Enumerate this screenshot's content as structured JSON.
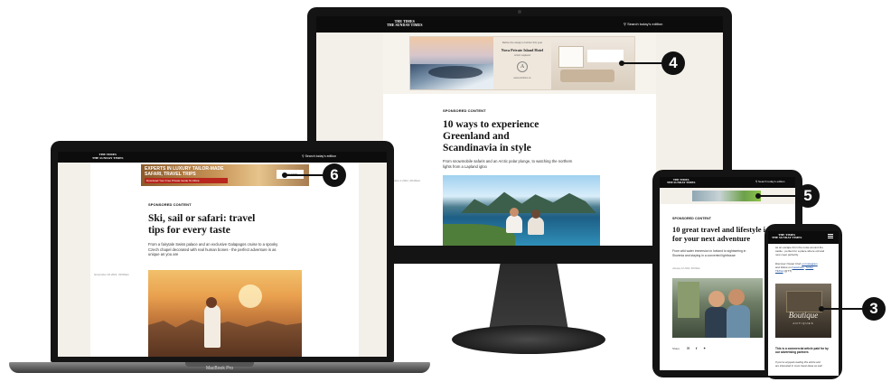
{
  "desktop": {
    "masthead": [
      "THE TIMES",
      "THE SUNDAY TIMES"
    ],
    "search_label": "Search today's edition",
    "ad": {
      "tagline": "Refine the design of winter this year",
      "hotel": "Nova Private Island Hotel",
      "location": "Arctic Lapland",
      "logo_glyph": "A",
      "url": "www.arcticlux.co"
    },
    "kicker": "SPONSORED CONTENT",
    "headline": [
      "10 ways to experience",
      "Greenland and",
      "Scandinavia in style"
    ],
    "standfirst": [
      "From snowmobile safaris and an Arctic polar plunge, to watching the northern",
      "lights from a Lapland igloo"
    ],
    "byline": "November 2 2021, 09:00am"
  },
  "laptop": {
    "masthead": [
      "THE TIMES",
      "THE SUNDAY TIMES"
    ],
    "search_label": "Search today's edition",
    "ad": {
      "title": "EXPERTS IN LUXURY TAILOR-MADE",
      "subtitle": "SAFARI, TRAVEL TRIPS",
      "cta": "Download Your Free Private Guide To Africa",
      "button": "PLAN NOW"
    },
    "kicker": "SPONSORED CONTENT",
    "headline": [
      "Ski, sail or safari: travel",
      "tips for every taste"
    ],
    "standfirst": [
      "From a fairytale Swiss palace and an exclusive Galapagos cruise to a spooky",
      "Czech chapel decorated with real human bones - the perfect adventure is as",
      "unique as you are"
    ],
    "byline": "November 16 2021, 09:00am",
    "brand": "MacBook Pro"
  },
  "tablet": {
    "masthead": [
      "THE TIMES",
      "THE SUNDAY TIMES"
    ],
    "search_label": "Search today's edition",
    "kicker": "SPONSORED CONTENT",
    "headline": [
      "10 great travel and lifestyle ide",
      "for your next adventure"
    ],
    "standfirst": [
      "From wild water immersion in Iceland to sightseeing in",
      "Slovenia and staying in a converted lighthouse"
    ],
    "byline": "January 12 2022, 09:00am",
    "share_label": "Share"
  },
  "phone": {
    "masthead": [
      "THE TIMES",
      "THE SUNDAY TIMES"
    ],
    "intro": [
      "as an escape from the noise around the",
      "castle - perfect for a place where old and",
      "new meet perfectly."
    ],
    "social_prefix": "Discover Ocean Club",
    "social_suffix": "on Instagram",
    "social_line2": "and follow on",
    "facebook": "Facebook",
    "twitter": "Twitter",
    "tiktok": "TikTok",
    "tiktok_suffix": "(@TT)",
    "shop_sign": "Boutique",
    "shop_sub": "ANTIQUES",
    "footer_bold": "This is a commercial article paid for by our advertising partners",
    "footer_small": [
      "If you've enjoyed reading this article and",
      "are interested in more travel ideas as well"
    ]
  },
  "callouts": [
    "3",
    "4",
    "5",
    "6"
  ]
}
